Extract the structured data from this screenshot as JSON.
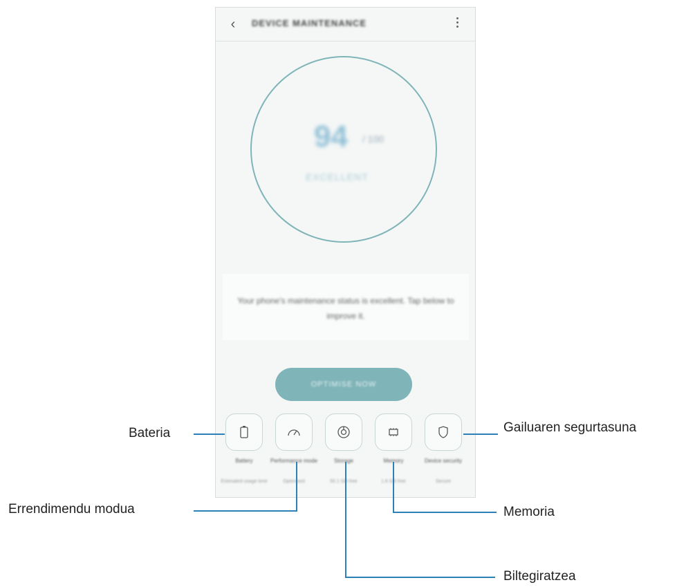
{
  "app": {
    "title": "DEVICE MAINTENANCE",
    "back_icon": "chevron-left-icon",
    "more_icon": "more-vertical-icon"
  },
  "score": {
    "value": "94",
    "unit": "/ 100",
    "label": "EXCELLENT"
  },
  "status_message": "Your phone's maintenance status is excellent. Tap below to improve it.",
  "optimize_label": "OPTIMISE NOW",
  "tiles": [
    {
      "label": "Battery",
      "sub": "Estimated usage time",
      "icon": "battery-icon"
    },
    {
      "label": "Performance mode",
      "sub": "Optimised",
      "icon": "speedometer-icon"
    },
    {
      "label": "Storage",
      "sub": "50.1 GB free",
      "icon": "storage-icon"
    },
    {
      "label": "Memory",
      "sub": "1.6 GB free",
      "icon": "memory-chip-icon"
    },
    {
      "label": "Device security",
      "sub": "Secure",
      "icon": "shield-icon"
    }
  ],
  "callouts": {
    "battery": "Bateria",
    "performance": "Errendimendu modua",
    "storage": "Biltegiratzea",
    "memory": "Memoria",
    "security": "Gailuaren segurtasuna"
  },
  "colors": {
    "accent": "#7fb4b8",
    "callout_line": "#2d7fb7"
  }
}
